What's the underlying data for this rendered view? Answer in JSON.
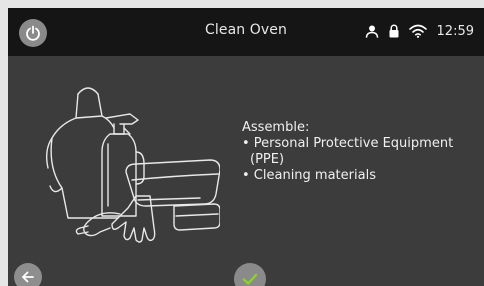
{
  "header": {
    "title": "Clean Oven",
    "time": "12:59",
    "icons": [
      "power-icon",
      "user-icon",
      "lock-icon",
      "wifi-icon"
    ]
  },
  "instructions": {
    "heading": "Assemble:",
    "items": [
      "• Personal Protective Equipment",
      "(PPE)",
      "• Cleaning materials"
    ]
  },
  "footer": {
    "icons": [
      "back-arrow-icon",
      "checkmark-icon"
    ]
  },
  "colors": {
    "statusbar": "#151515",
    "background": "#3c3c3c",
    "button": "#8a8a8a",
    "check": "#8bd22a"
  }
}
